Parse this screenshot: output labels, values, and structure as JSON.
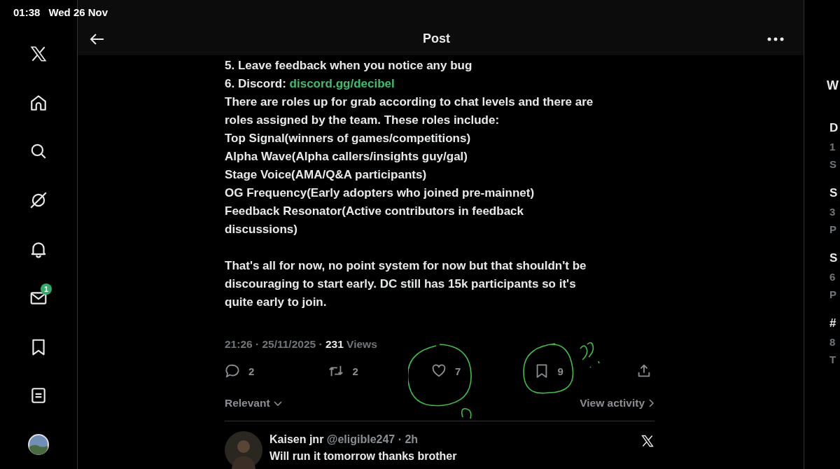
{
  "status_bar": {
    "time": "01:38",
    "date": "Wed 26 Nov"
  },
  "sidebar": {
    "messages_badge": "1"
  },
  "header": {
    "title": "Post"
  },
  "post": {
    "paragraphs": [
      [
        {
          "text": "5. Leave feedback when you notice any bug"
        },
        {
          "text": "6. Discord: ",
          "link": "discord.gg/decibel"
        },
        {
          "text": "There are roles up for grab according to chat levels and  there are"
        },
        {
          "text": "roles assigned by the team. These roles include:"
        },
        {
          "text": "Top Signal(winners of games/competitions)"
        },
        {
          "text": "Alpha Wave(Alpha callers/insights guy/gal)"
        },
        {
          "text": "Stage Voice(AMA/Q&A participants)"
        },
        {
          "text": "OG Frequency(Early adopters who joined pre-mainnet)"
        },
        {
          "text": "Feedback Resonator(Active contributors in feedback"
        },
        {
          "text": "discussions)"
        }
      ],
      [
        {
          "text": "That's all for now, no point system for now but that shouldn't be"
        },
        {
          "text": "discouraging to start early. DC still has 15k participants so it's"
        },
        {
          "text": "quite early to join."
        }
      ]
    ],
    "meta": {
      "time": "21:26 · 25/11/2025 · ",
      "views_count": "231",
      "views_label": " Views"
    },
    "action_counts": [
      "2",
      "2",
      "7",
      "9"
    ],
    "sort": "Relevant",
    "view_activity": "View activity"
  },
  "reply": {
    "name": "Kaisen jnr",
    "handle": "@eligible247 · 2h",
    "text": "Will run it tomorrow thanks brother"
  },
  "right_panel": {
    "heading": "W",
    "trends": [
      [
        "D",
        "1",
        "S"
      ],
      [
        "S",
        "3",
        "P"
      ],
      [
        "S",
        "6",
        "P"
      ],
      [
        "#",
        "8",
        "T"
      ]
    ]
  }
}
